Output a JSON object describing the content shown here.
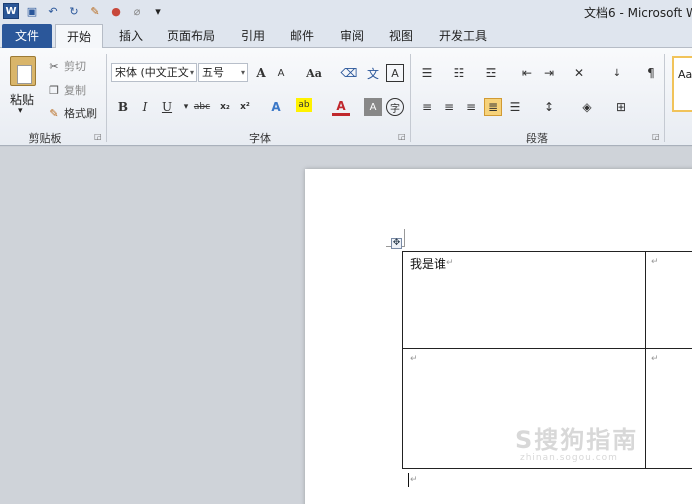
{
  "window": {
    "title": "文档6 - Microsoft W"
  },
  "quick_access": {
    "word_logo": "W",
    "save_icon": "save-icon",
    "undo_icon": "undo-icon",
    "redo_icon": "redo-icon",
    "customize": "▾"
  },
  "tabs": [
    {
      "label": "文件"
    },
    {
      "label": "开始"
    },
    {
      "label": "插入"
    },
    {
      "label": "页面布局"
    },
    {
      "label": "引用"
    },
    {
      "label": "邮件"
    },
    {
      "label": "审阅"
    },
    {
      "label": "视图"
    },
    {
      "label": "开发工具"
    }
  ],
  "clipboard": {
    "group_label": "剪贴板",
    "paste_label": "粘贴",
    "cut_label": "剪切",
    "copy_label": "复制",
    "format_painter_label": "格式刷"
  },
  "font": {
    "group_label": "字体",
    "font_name": "宋体 (中文正文",
    "font_size": "五号",
    "grow": "A",
    "shrink": "A",
    "change_case": "Aa",
    "bold": "B",
    "italic": "I",
    "underline": "U",
    "strikethrough": "abc",
    "subscript": "x₂",
    "superscript": "x²",
    "text_effect": "A",
    "font_color": "A",
    "char_shading": "A",
    "enclose": "字"
  },
  "paragraph": {
    "group_label": "段落"
  },
  "styles": {
    "sample": "Aa"
  },
  "document": {
    "cell_1_text": "我是谁",
    "para_mark": "↵"
  },
  "watermark": {
    "text": "S搜狗指南",
    "sub": "zhinan.sogou.com"
  },
  "colors": {
    "file_tab": "#2b579a",
    "highlight": "#f6d27a"
  }
}
